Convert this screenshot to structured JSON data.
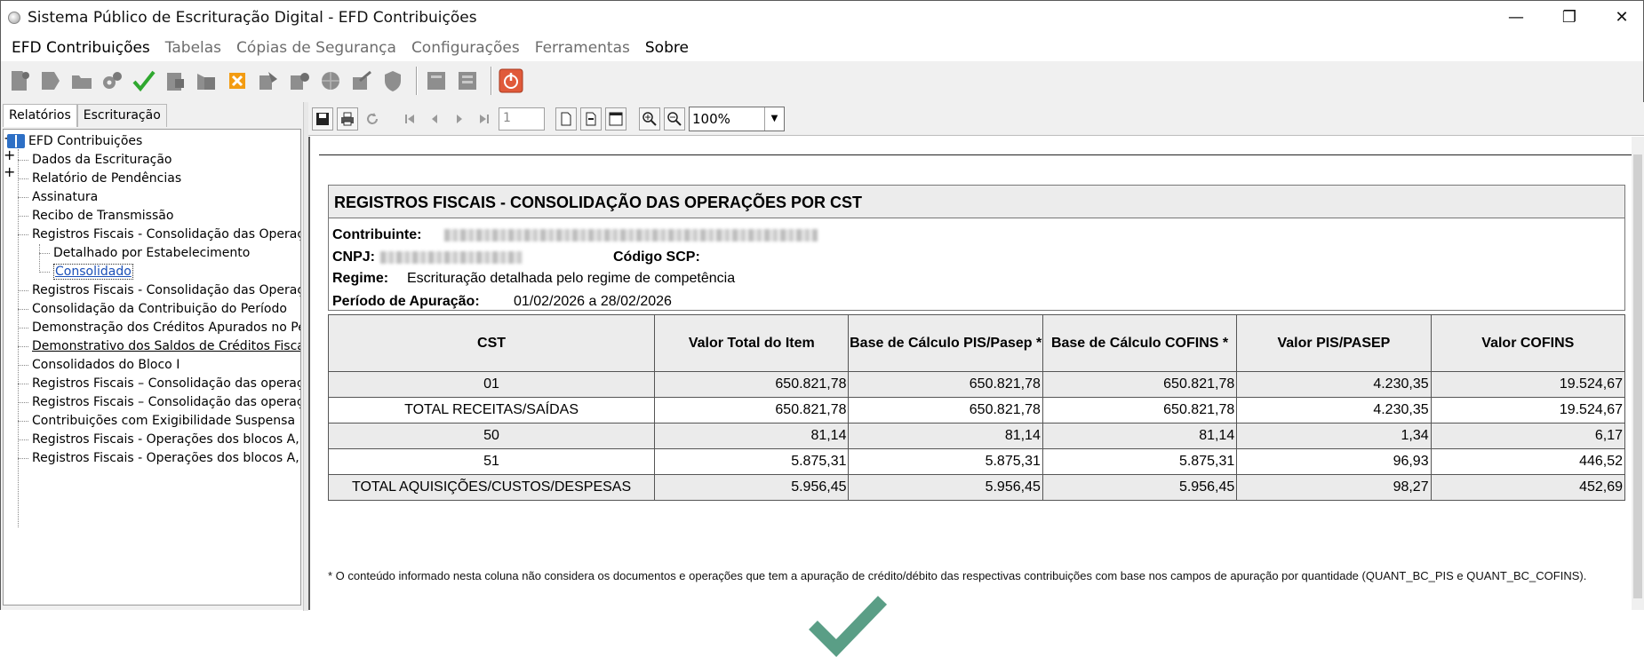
{
  "window": {
    "title": "Sistema Público de Escrituração Digital - EFD Contribuições",
    "minimize_label": "—",
    "maximize_label": "❐",
    "close_label": "✕"
  },
  "menu": [
    {
      "label": "EFD Contribuições",
      "enabled": true
    },
    {
      "label": "Tabelas",
      "enabled": false
    },
    {
      "label": "Cópias de Segurança",
      "enabled": false
    },
    {
      "label": "Configurações",
      "enabled": false
    },
    {
      "label": "Ferramentas",
      "enabled": false
    },
    {
      "label": "Sobre",
      "enabled": true
    }
  ],
  "left_tabs": [
    "Relatórios",
    "Escrituração"
  ],
  "tree": {
    "root": "EFD Contribuições",
    "items": [
      "Dados da Escrituração",
      "Relatório de Pendências",
      "Assinatura",
      "Recibo de Transmissão",
      "Registros Fiscais - Consolidação das Operaçõ",
      "Detalhado por Estabelecimento",
      "Consolidado",
      "Registros Fiscais - Consolidação das Operaçõ",
      "Consolidação da Contribuição do Período",
      "Demonstração dos Créditos Apurados no Perío",
      "Demonstrativo dos Saldos de Créditos Fiscais",
      "Consolidados do Bloco I",
      "Registros Fiscais – Consolidação das operaçõ",
      "Registros Fiscais – Consolidação das operaçõ",
      "Contribuições com Exigibilidade Suspensa",
      "Registros Fiscais - Operações dos blocos A, C",
      "Registros Fiscais - Operações dos blocos A, C"
    ],
    "expander_collapse": "−",
    "expander_expand": "+"
  },
  "viewer": {
    "page_number": "1",
    "zoom": "100%"
  },
  "report": {
    "title": "REGISTROS FISCAIS - CONSOLIDAÇÃO DAS OPERAÇÕES POR CST",
    "contribuinte_label": "Contribuinte:",
    "cnpj_label": "CNPJ:",
    "codigo_scp_label": "Código SCP:",
    "regime_label": "Regime:",
    "regime_value": "Escrituração detalhada pelo regime de competência",
    "periodo_label": "Período de Apuração:",
    "periodo_value": "01/02/2026 a 28/02/2026",
    "columns": [
      "CST",
      "Valor Total do Item",
      "Base de Cálculo PIS/Pasep *",
      "Base de Cálculo COFINS *",
      "Valor PIS/PASEP",
      "Valor COFINS"
    ],
    "rows": [
      [
        "01",
        "650.821,78",
        "650.821,78",
        "650.821,78",
        "4.230,35",
        "19.524,67"
      ],
      [
        "TOTAL RECEITAS/SAÍDAS",
        "650.821,78",
        "650.821,78",
        "650.821,78",
        "4.230,35",
        "19.524,67"
      ],
      [
        "50",
        "81,14",
        "81,14",
        "81,14",
        "1,34",
        "6,17"
      ],
      [
        "51",
        "5.875,31",
        "5.875,31",
        "5.875,31",
        "96,93",
        "446,52"
      ],
      [
        "TOTAL AQUISIÇÕES/CUSTOS/DESPESAS",
        "5.956,45",
        "5.956,45",
        "5.956,45",
        "98,27",
        "452,69"
      ]
    ],
    "footnote": "* O conteúdo informado nesta coluna não considera os documentos e operações que tem a apuração de crédito/débito das respectivas contribuições com base nos campos de apuração por quantidade (QUANT_BC_PIS e QUANT_BC_COFINS)."
  },
  "colors": {
    "check_green": "#5a9e86",
    "tree_selected": "#1a4fb8",
    "table_shade": "#ebebeb"
  }
}
